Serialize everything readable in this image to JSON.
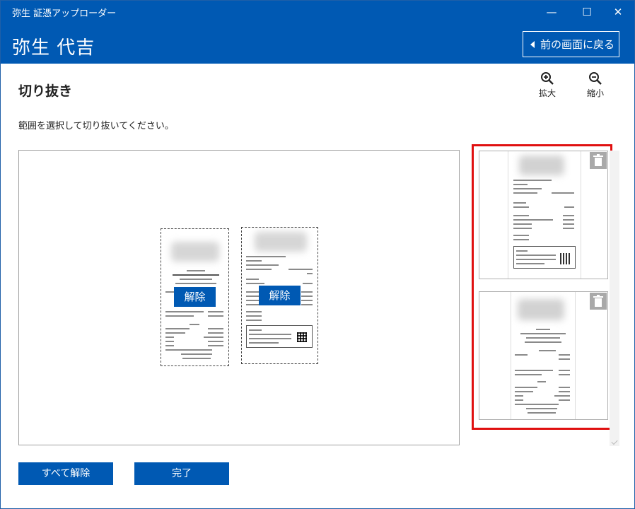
{
  "window": {
    "title": "弥生 証憑アップローダー",
    "minimize": "—",
    "maximize": "☐",
    "close": "✕"
  },
  "header": {
    "company": "弥生 代吉",
    "back_button": "前の画面に戻る"
  },
  "page": {
    "title": "切り抜き",
    "instruction": "範囲を選択して切り抜いてください。"
  },
  "zoom": {
    "in_label": "拡大",
    "in_icon": "zoom-in-icon",
    "out_label": "縮小",
    "out_icon": "zoom-out-icon"
  },
  "canvas": {
    "receipts": [
      {
        "release_label": "解除"
      },
      {
        "release_label": "解除"
      }
    ]
  },
  "thumbnails": {
    "highlight_color": "#e01010",
    "items": [
      {
        "delete_icon": "trash-icon"
      },
      {
        "delete_icon": "trash-icon"
      }
    ]
  },
  "footer": {
    "release_all": "すべて解除",
    "done": "完了"
  },
  "colors": {
    "brand": "#0059b3"
  }
}
